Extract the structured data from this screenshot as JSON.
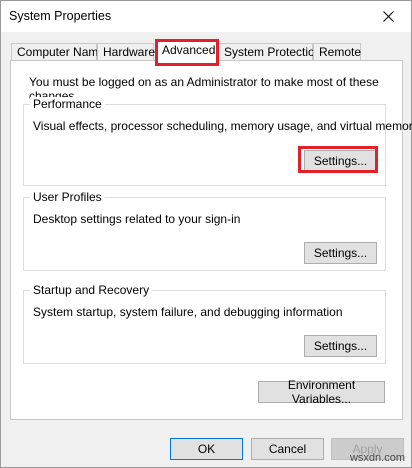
{
  "window": {
    "title": "System Properties"
  },
  "tabs": [
    {
      "label": "Computer Name"
    },
    {
      "label": "Hardware"
    },
    {
      "label": "Advanced",
      "active": true
    },
    {
      "label": "System Protection"
    },
    {
      "label": "Remote"
    }
  ],
  "advanced": {
    "admin_note": "You must be logged on as an Administrator to make most of these changes.",
    "performance": {
      "title": "Performance",
      "description": "Visual effects, processor scheduling, memory usage, and virtual memory",
      "button": "Settings..."
    },
    "user_profiles": {
      "title": "User Profiles",
      "description": "Desktop settings related to your sign-in",
      "button": "Settings..."
    },
    "startup_recovery": {
      "title": "Startup and Recovery",
      "description": "System startup, system failure, and debugging information",
      "button": "Settings..."
    },
    "env_button": "Environment Variables..."
  },
  "footer": {
    "ok": "OK",
    "cancel": "Cancel",
    "apply": "Apply"
  },
  "watermark": "wsxdn.com",
  "colors": {
    "highlight": "#e0202a"
  },
  "icons": {
    "close": "close-icon"
  }
}
